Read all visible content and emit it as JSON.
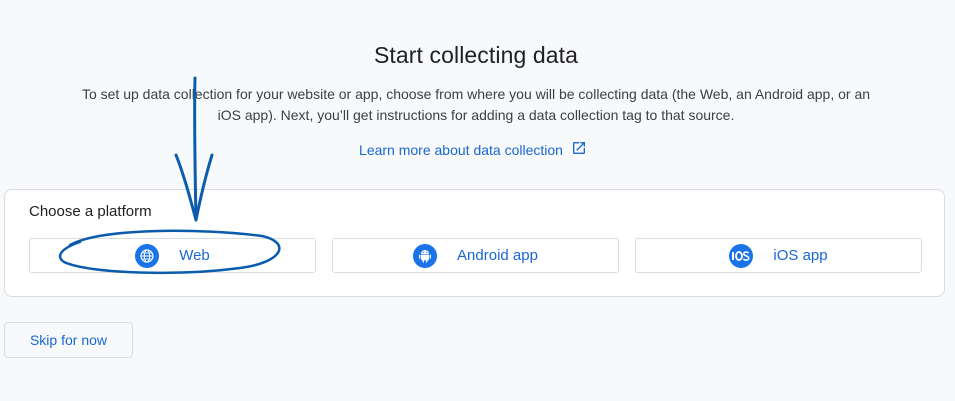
{
  "header": {
    "title": "Start collecting data",
    "description": "To set up data collection for your website or app, choose from where you will be collecting data (the Web, an Android app, or an iOS app). Next, you’ll get instructions for adding a data collection tag to that source.",
    "learn_more_label": "Learn more about data collection",
    "learn_more_icon": "open-in-new-icon"
  },
  "platform_card": {
    "title": "Choose a platform",
    "options": [
      {
        "label": "Web",
        "icon": "globe-icon"
      },
      {
        "label": "Android app",
        "icon": "android-icon"
      },
      {
        "label": "iOS app",
        "icon": "ios-icon"
      }
    ]
  },
  "footer": {
    "skip_label": "Skip for now"
  },
  "colors": {
    "accent": "#1967d2",
    "icon_bg": "#1a73e8",
    "annotation": "#0b5cad"
  }
}
